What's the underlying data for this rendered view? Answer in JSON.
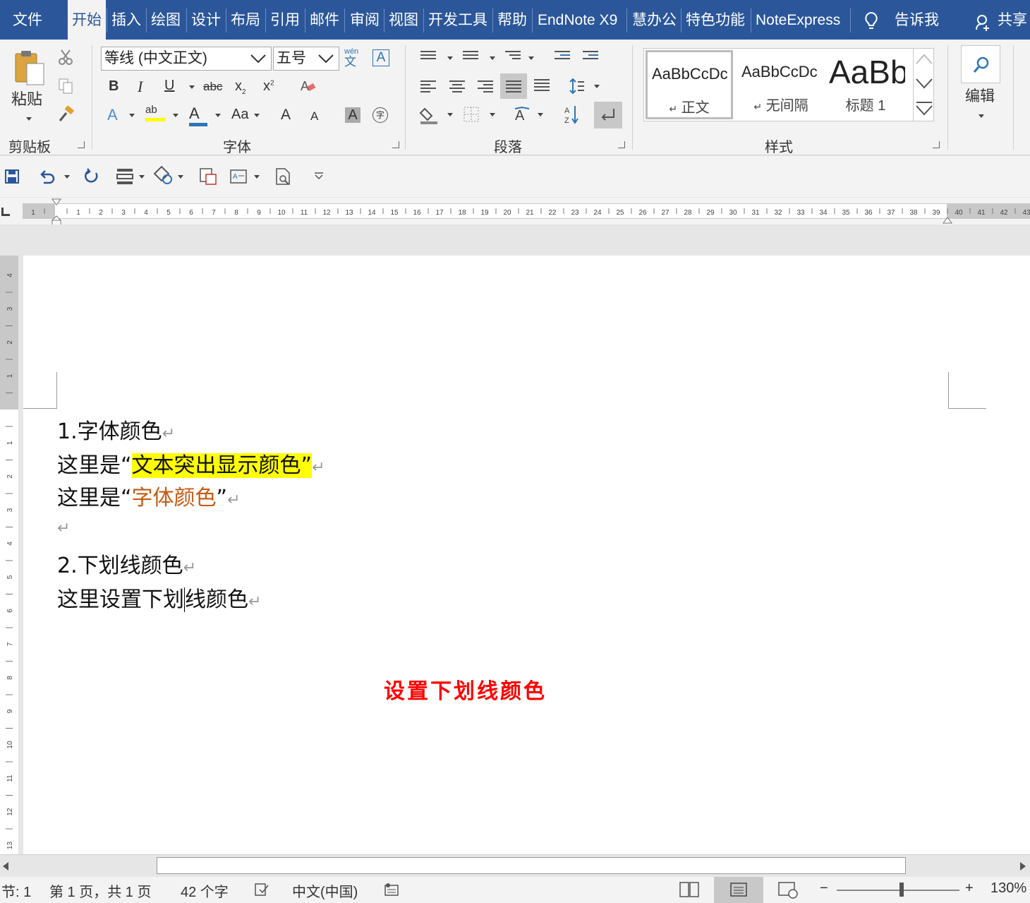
{
  "tabs": [
    "文件",
    "开始",
    "插入",
    "绘图",
    "设计",
    "布局",
    "引用",
    "邮件",
    "审阅",
    "视图",
    "开发工具",
    "帮助",
    "EndNote X9",
    "慧办公",
    "特色功能",
    "NoteExpress"
  ],
  "active_tab": "开始",
  "tell_me": "告诉我",
  "share": "共享",
  "clipboard": {
    "paste": "粘贴",
    "group": "剪贴板"
  },
  "font": {
    "name": "等线 (中文正文)",
    "size": "五号",
    "wen": "wén",
    "wen_char": "文",
    "group": "字体",
    "bold": "B",
    "italic": "I",
    "underline": "U",
    "strike": "abc",
    "sub": "x",
    "sub_mark": "2",
    "sup": "x",
    "sup_mark": "2",
    "effects": "A",
    "highlight": "ab",
    "fontcolor": "A",
    "case": "Aa",
    "grow": "A",
    "shrink": "A",
    "shade": "A",
    "phonetic": "字",
    "highlight_color": "#ffff00",
    "fontcolor_color": "#2e75b6"
  },
  "paragraph": {
    "group": "段落"
  },
  "styles": {
    "group": "样式",
    "items": [
      {
        "preview": "AaBbCcDc",
        "name": "正文",
        "mark": "↵"
      },
      {
        "preview": "AaBbCcDc",
        "name": "无间隔",
        "mark": "↵"
      },
      {
        "preview": "AaBb",
        "name": "标题 1",
        "mark": ""
      }
    ]
  },
  "editing": {
    "label": "编辑"
  },
  "ruler_numbers": [
    "1",
    "",
    "1",
    "2",
    "3",
    "4",
    "5",
    "6",
    "7",
    "8",
    "9",
    "10",
    "11",
    "12",
    "13",
    "14",
    "15",
    "16",
    "17",
    "18",
    "19",
    "20",
    "21",
    "22",
    "23",
    "24",
    "25",
    "26",
    "27",
    "28",
    "29",
    "30",
    "31",
    "32",
    "33",
    "34",
    "35",
    "36",
    "37",
    "38",
    "39",
    "40",
    "41",
    "42",
    "43"
  ],
  "vruler_numbers": [
    "4",
    "3",
    "2",
    "1",
    "",
    "1",
    "2",
    "3",
    "4",
    "5",
    "6",
    "7",
    "8",
    "9",
    "10",
    "11",
    "12",
    "13"
  ],
  "document": {
    "heading1": "1.字体颜色",
    "line2_prefix": "这里是“",
    "line2_highlight": "文本突出显示颜色",
    "line2_suffix": "”",
    "line3_prefix": "这里是“",
    "line3_colored": "字体颜色",
    "line3_suffix": "”",
    "heading2": "2.下划线颜色",
    "line6_a": "这里设置",
    "line6_b": "下划",
    "line6_c": "线颜色",
    "paragraph_mark": "↵",
    "caption": "设置下划线颜色",
    "caption_color": "#ff0000",
    "highlight_color": "#ffff00",
    "font_color": "#c55a11"
  },
  "status": {
    "section": "节: 1",
    "page": "第 1 页，共 1 页",
    "words": "42 个字",
    "language": "中文(中国)",
    "zoom": "130%",
    "zoom_minus": "−",
    "zoom_plus": "+"
  }
}
